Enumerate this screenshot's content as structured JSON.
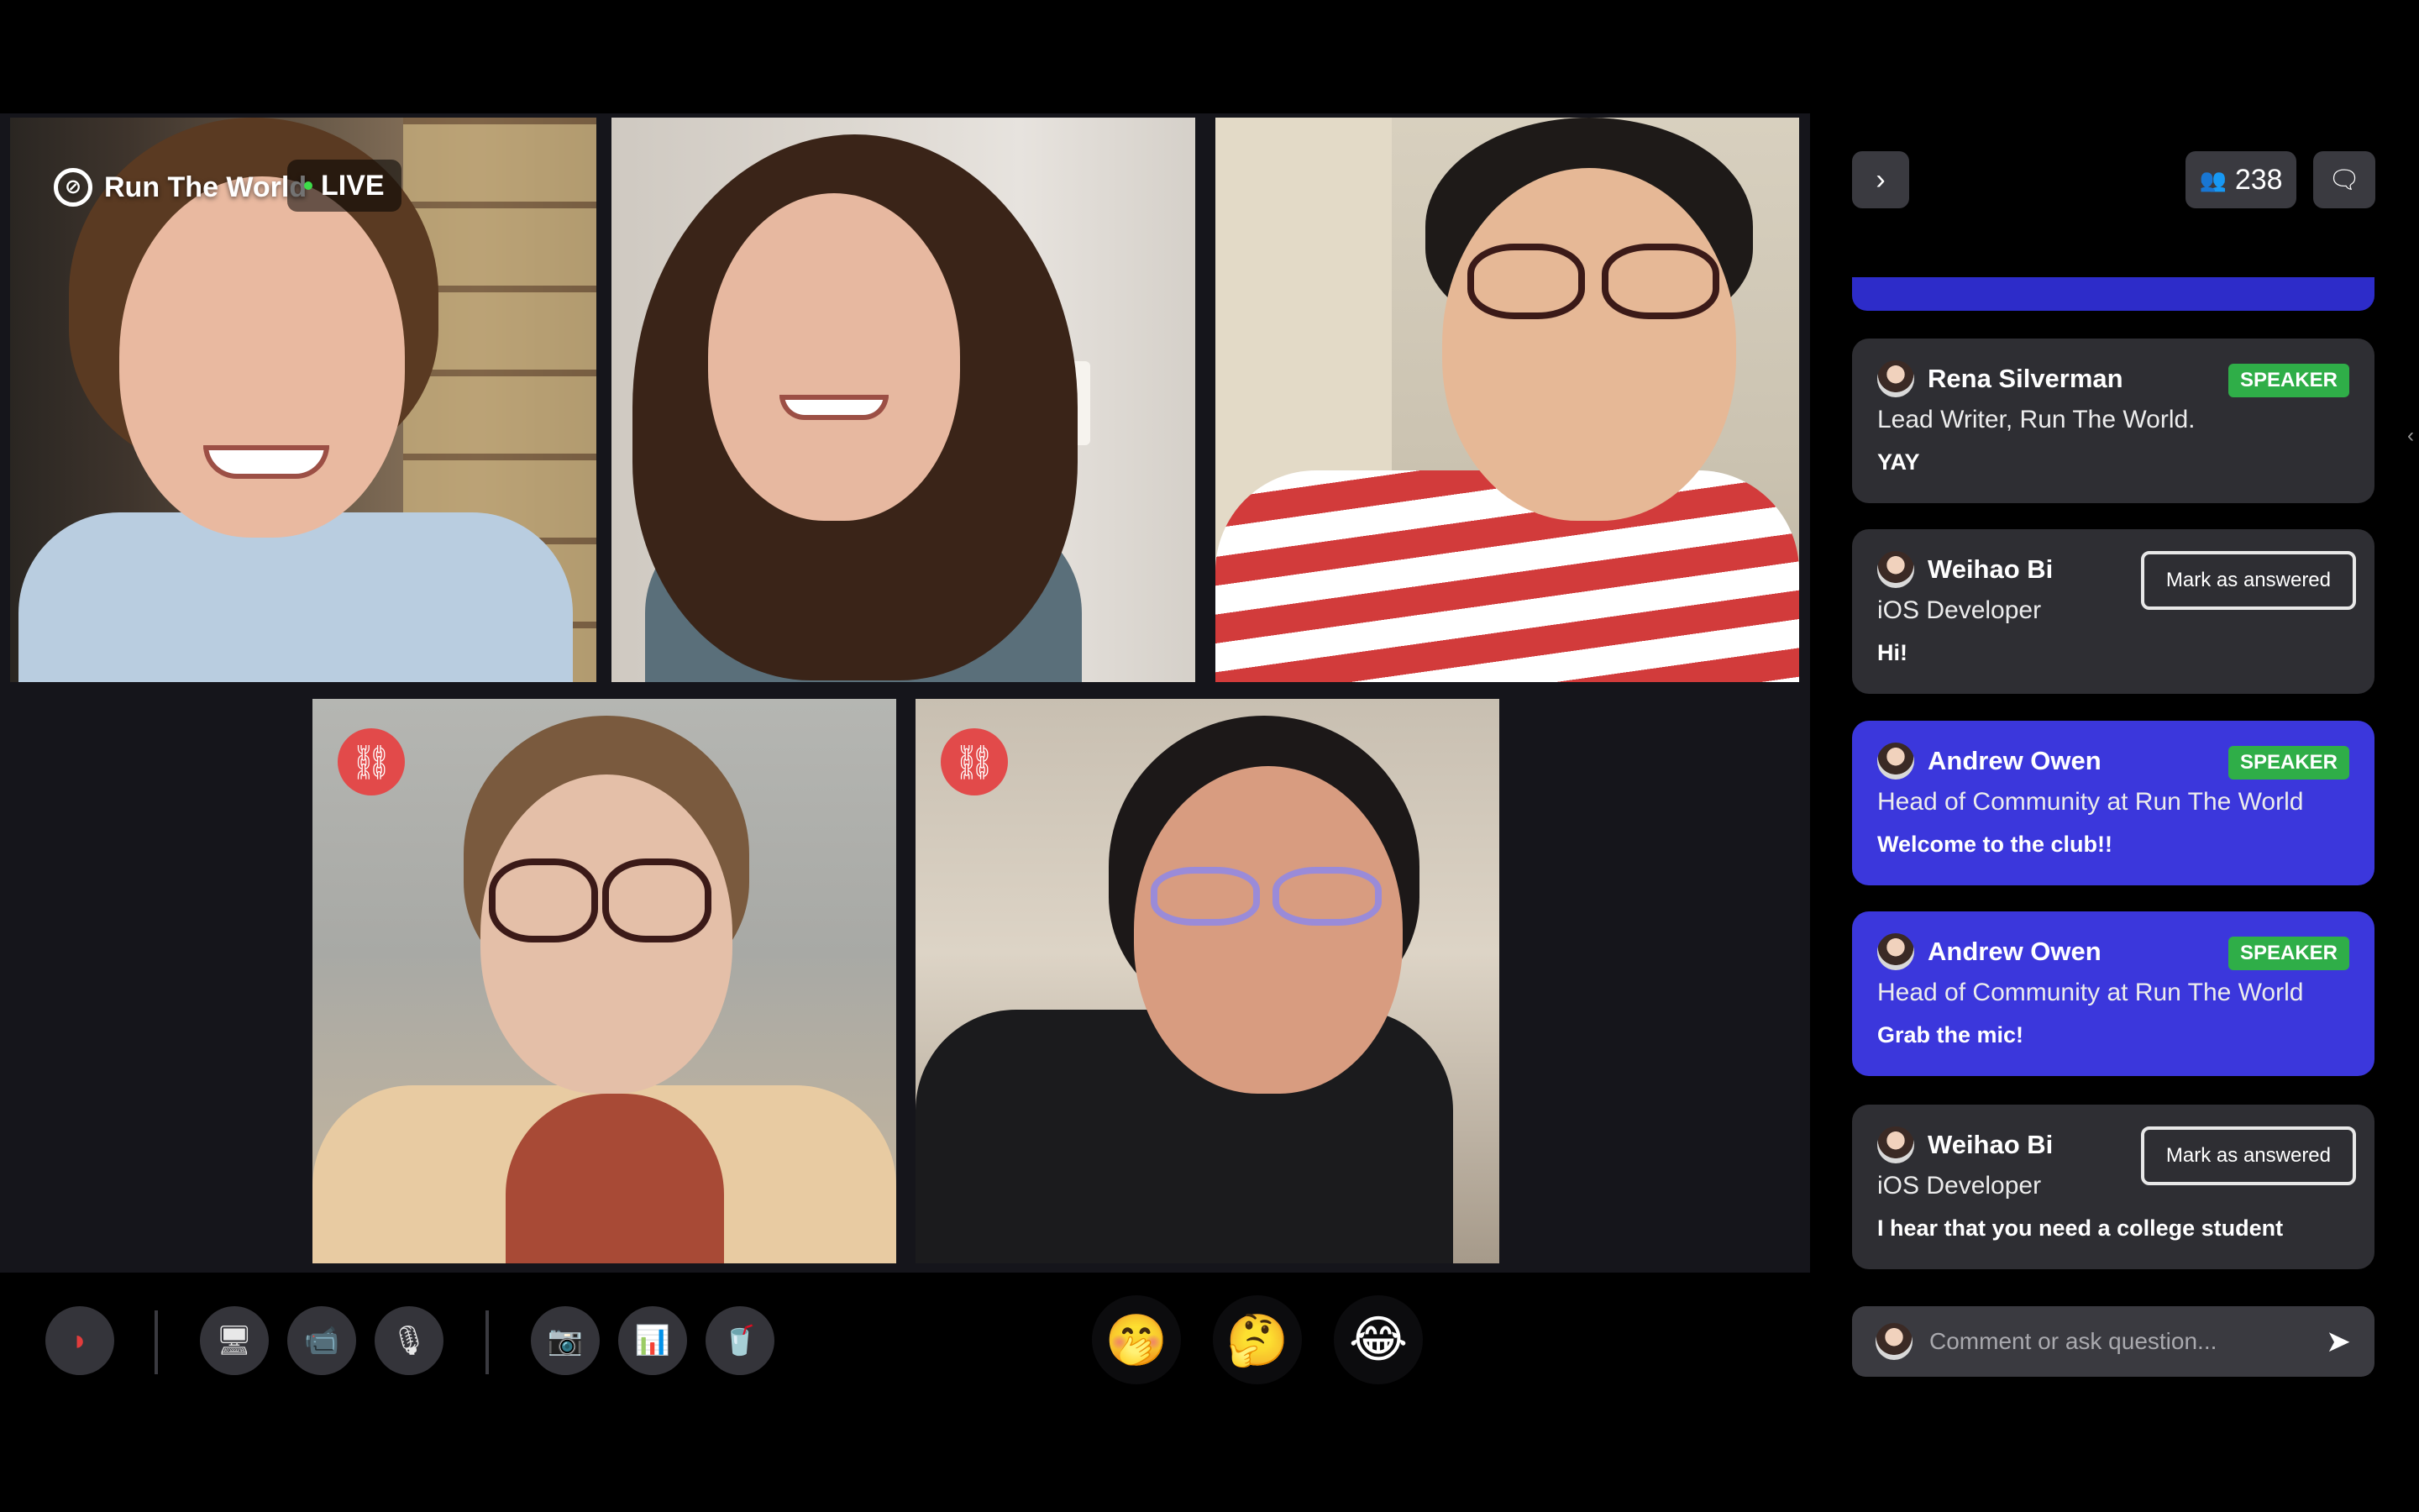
{
  "overlay": {
    "brand_name": "Run The World",
    "live_label": "LIVE",
    "brand_logo_glyph": "⊘",
    "link_glyph": "⛓"
  },
  "colors": {
    "speaker_badge": "#2fae48",
    "card_highlight": "#3b37dc",
    "active_speaker_border": "#45c93a",
    "link_badge": "#e24a4a"
  },
  "panel": {
    "collapse_glyph": "›",
    "attendee_icon": "👥",
    "attendee_count": "238",
    "chat_icon": "🗨",
    "cards": [
      {
        "name": "Rena Silverman",
        "role": "Lead Writer, Run The World.",
        "message": "YAY",
        "badge": "SPEAKER",
        "action": ""
      },
      {
        "name": "Weihao Bi",
        "role": "iOS Developer",
        "message": "Hi!",
        "badge": "",
        "action": "Mark as answered"
      },
      {
        "name": "Andrew Owen",
        "role": "Head of Community at Run The World",
        "message": "Welcome to the club!!",
        "badge": "SPEAKER",
        "action": ""
      },
      {
        "name": "Andrew Owen",
        "role": "Head of Community at Run The World",
        "message": "Grab the mic!",
        "badge": "SPEAKER",
        "action": ""
      },
      {
        "name": "Weihao Bi",
        "role": "iOS Developer",
        "message": "I hear that you need a college student",
        "badge": "",
        "action": "Mark as answered"
      }
    ],
    "comment_placeholder": "Comment or ask question...",
    "send_glyph": "➤"
  },
  "toolbar": {
    "leave_icon": "◗",
    "screen_share_icon": "🖥",
    "camera_icon": "📹",
    "mic_icon": "🎙",
    "photo_icon": "📷",
    "poll_icon": "📊",
    "drink_icon": "🥤",
    "reactions": [
      "🤭",
      "🤔",
      "😂"
    ]
  },
  "edge_glyph": "‹"
}
